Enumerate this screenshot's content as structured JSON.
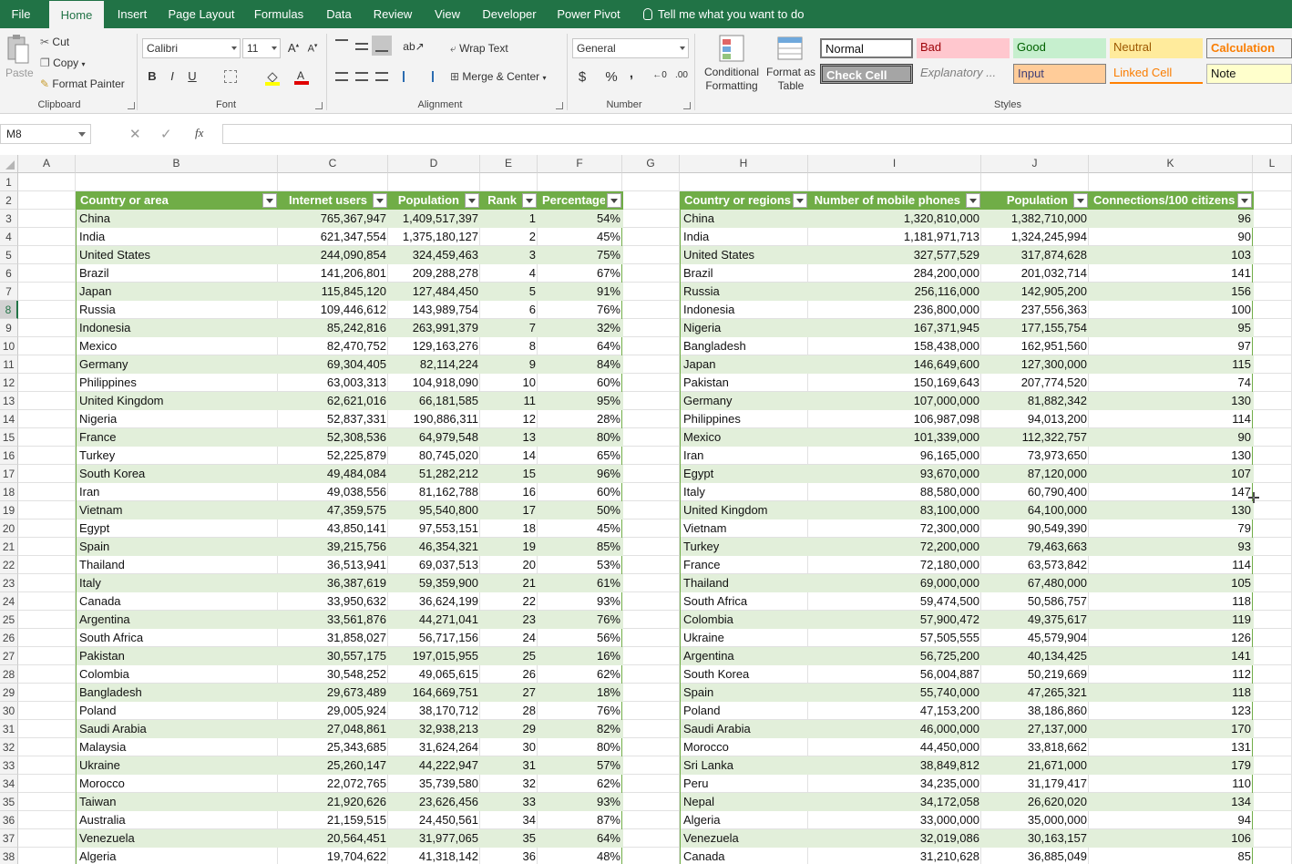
{
  "tabs": [
    "File",
    "Home",
    "Insert",
    "Page Layout",
    "Formulas",
    "Data",
    "Review",
    "View",
    "Developer",
    "Power Pivot"
  ],
  "tell_me": "Tell me what you want to do",
  "clipboard": {
    "paste": "Paste",
    "cut": "Cut",
    "copy": "Copy",
    "format_painter": "Format Painter",
    "label": "Clipboard"
  },
  "font": {
    "name": "Calibri",
    "size": "11",
    "label": "Font",
    "bold": "B",
    "italic": "I",
    "underline": "U"
  },
  "alignment": {
    "wrap": "Wrap Text",
    "merge": "Merge & Center",
    "label": "Alignment"
  },
  "number": {
    "format": "General",
    "label": "Number",
    "currency": "$",
    "percent": "%",
    "comma": ","
  },
  "styles": {
    "label": "Styles",
    "conditional_formatting": "Conditional Formatting",
    "format_as_table": "Format as Table",
    "normal": "Normal",
    "bad": "Bad",
    "good": "Good",
    "neutral": "Neutral",
    "calculation": "Calculation",
    "check_cell": "Check Cell",
    "explanatory": "Explanatory ...",
    "input": "Input",
    "linked_cell": "Linked Cell",
    "note": "Note"
  },
  "name_box": "M8",
  "fx": "fx",
  "columns": [
    "A",
    "B",
    "C",
    "D",
    "E",
    "F",
    "G",
    "H",
    "I",
    "J",
    "K",
    "L"
  ],
  "rows": [
    "1",
    "2",
    "3",
    "4",
    "5",
    "6",
    "7",
    "8",
    "9",
    "10",
    "11",
    "12",
    "13",
    "14",
    "15",
    "16",
    "17",
    "18",
    "19",
    "20",
    "21",
    "22",
    "23",
    "24",
    "25",
    "26",
    "27",
    "28",
    "29",
    "30",
    "31",
    "32",
    "33",
    "34",
    "35",
    "36",
    "37",
    "38"
  ],
  "selected_row": "8",
  "table1": {
    "headers": [
      "Country or area",
      "Internet users",
      "Population",
      "Rank",
      "Percentage"
    ],
    "rows": [
      [
        "China",
        "765,367,947",
        "1,409,517,397",
        "1",
        "54%"
      ],
      [
        "India",
        "621,347,554",
        "1,375,180,127",
        "2",
        "45%"
      ],
      [
        "United States",
        "244,090,854",
        "324,459,463",
        "3",
        "75%"
      ],
      [
        "Brazil",
        "141,206,801",
        "209,288,278",
        "4",
        "67%"
      ],
      [
        "Japan",
        "115,845,120",
        "127,484,450",
        "5",
        "91%"
      ],
      [
        "Russia",
        "109,446,612",
        "143,989,754",
        "6",
        "76%"
      ],
      [
        "Indonesia",
        "85,242,816",
        "263,991,379",
        "7",
        "32%"
      ],
      [
        "Mexico",
        "82,470,752",
        "129,163,276",
        "8",
        "64%"
      ],
      [
        "Germany",
        "69,304,405",
        "82,114,224",
        "9",
        "84%"
      ],
      [
        "Philippines",
        "63,003,313",
        "104,918,090",
        "10",
        "60%"
      ],
      [
        "United Kingdom",
        "62,621,016",
        "66,181,585",
        "11",
        "95%"
      ],
      [
        "Nigeria",
        "52,837,331",
        "190,886,311",
        "12",
        "28%"
      ],
      [
        "France",
        "52,308,536",
        "64,979,548",
        "13",
        "80%"
      ],
      [
        "Turkey",
        "52,225,879",
        "80,745,020",
        "14",
        "65%"
      ],
      [
        "South Korea",
        "49,484,084",
        "51,282,212",
        "15",
        "96%"
      ],
      [
        "Iran",
        "49,038,556",
        "81,162,788",
        "16",
        "60%"
      ],
      [
        "Vietnam",
        "47,359,575",
        "95,540,800",
        "17",
        "50%"
      ],
      [
        "Egypt",
        "43,850,141",
        "97,553,151",
        "18",
        "45%"
      ],
      [
        "Spain",
        "39,215,756",
        "46,354,321",
        "19",
        "85%"
      ],
      [
        "Thailand",
        "36,513,941",
        "69,037,513",
        "20",
        "53%"
      ],
      [
        "Italy",
        "36,387,619",
        "59,359,900",
        "21",
        "61%"
      ],
      [
        "Canada",
        "33,950,632",
        "36,624,199",
        "22",
        "93%"
      ],
      [
        "Argentina",
        "33,561,876",
        "44,271,041",
        "23",
        "76%"
      ],
      [
        "South Africa",
        "31,858,027",
        "56,717,156",
        "24",
        "56%"
      ],
      [
        "Pakistan",
        "30,557,175",
        "197,015,955",
        "25",
        "16%"
      ],
      [
        "Colombia",
        "30,548,252",
        "49,065,615",
        "26",
        "62%"
      ],
      [
        "Bangladesh",
        "29,673,489",
        "164,669,751",
        "27",
        "18%"
      ],
      [
        "Poland",
        "29,005,924",
        "38,170,712",
        "28",
        "76%"
      ],
      [
        "Saudi Arabia",
        "27,048,861",
        "32,938,213",
        "29",
        "82%"
      ],
      [
        "Malaysia",
        "25,343,685",
        "31,624,264",
        "30",
        "80%"
      ],
      [
        "Ukraine",
        "25,260,147",
        "44,222,947",
        "31",
        "57%"
      ],
      [
        "Morocco",
        "22,072,765",
        "35,739,580",
        "32",
        "62%"
      ],
      [
        "Taiwan",
        "21,920,626",
        "23,626,456",
        "33",
        "93%"
      ],
      [
        "Australia",
        "21,159,515",
        "24,450,561",
        "34",
        "87%"
      ],
      [
        "Venezuela",
        "20,564,451",
        "31,977,065",
        "35",
        "64%"
      ],
      [
        "Algeria",
        "19,704,622",
        "41,318,142",
        "36",
        "48%"
      ]
    ]
  },
  "table2": {
    "headers": [
      "Country or regions",
      "Number of mobile phones",
      "Population",
      "Connections/100 citizens"
    ],
    "rows": [
      [
        "China",
        "1,320,810,000",
        "1,382,710,000",
        "96"
      ],
      [
        "India",
        "1,181,971,713",
        "1,324,245,994",
        "90"
      ],
      [
        "United States",
        "327,577,529",
        "317,874,628",
        "103"
      ],
      [
        "Brazil",
        "284,200,000",
        "201,032,714",
        "141"
      ],
      [
        "Russia",
        "256,116,000",
        "142,905,200",
        "156"
      ],
      [
        "Indonesia",
        "236,800,000",
        "237,556,363",
        "100"
      ],
      [
        "Nigeria",
        "167,371,945",
        "177,155,754",
        "95"
      ],
      [
        "Bangladesh",
        "158,438,000",
        "162,951,560",
        "97"
      ],
      [
        "Japan",
        "146,649,600",
        "127,300,000",
        "115"
      ],
      [
        "Pakistan",
        "150,169,643",
        "207,774,520",
        "74"
      ],
      [
        "Germany",
        "107,000,000",
        "81,882,342",
        "130"
      ],
      [
        "Philippines",
        "106,987,098",
        "94,013,200",
        "114"
      ],
      [
        "Mexico",
        "101,339,000",
        "112,322,757",
        "90"
      ],
      [
        "Iran",
        "96,165,000",
        "73,973,650",
        "130"
      ],
      [
        "Egypt",
        "93,670,000",
        "87,120,000",
        "107"
      ],
      [
        "Italy",
        "88,580,000",
        "60,790,400",
        "147"
      ],
      [
        "United Kingdom",
        "83,100,000",
        "64,100,000",
        "130"
      ],
      [
        "Vietnam",
        "72,300,000",
        "90,549,390",
        "79"
      ],
      [
        "Turkey",
        "72,200,000",
        "79,463,663",
        "93"
      ],
      [
        "France",
        "72,180,000",
        "63,573,842",
        "114"
      ],
      [
        "Thailand",
        "69,000,000",
        "67,480,000",
        "105"
      ],
      [
        "South Africa",
        "59,474,500",
        "50,586,757",
        "118"
      ],
      [
        "Colombia",
        "57,900,472",
        "49,375,617",
        "119"
      ],
      [
        "Ukraine",
        "57,505,555",
        "45,579,904",
        "126"
      ],
      [
        "Argentina",
        "56,725,200",
        "40,134,425",
        "141"
      ],
      [
        "South Korea",
        "56,004,887",
        "50,219,669",
        "112"
      ],
      [
        "Spain",
        "55,740,000",
        "47,265,321",
        "118"
      ],
      [
        "Poland",
        "47,153,200",
        "38,186,860",
        "123"
      ],
      [
        "Saudi Arabia",
        "46,000,000",
        "27,137,000",
        "170"
      ],
      [
        "Morocco",
        "44,450,000",
        "33,818,662",
        "131"
      ],
      [
        "Sri Lanka",
        "38,849,812",
        "21,671,000",
        "179"
      ],
      [
        "Peru",
        "34,235,000",
        "31,179,417",
        "110"
      ],
      [
        "Nepal",
        "34,172,058",
        "26,620,020",
        "134"
      ],
      [
        "Algeria",
        "33,000,000",
        "35,000,000",
        "94"
      ],
      [
        "Venezuela",
        "32,019,086",
        "30,163,157",
        "106"
      ],
      [
        "Canada",
        "31,210,628",
        "36,885,049",
        "85"
      ]
    ]
  },
  "colors": {
    "excel_green": "#217346",
    "table_header": "#70ad47",
    "band": "#e2efda"
  }
}
